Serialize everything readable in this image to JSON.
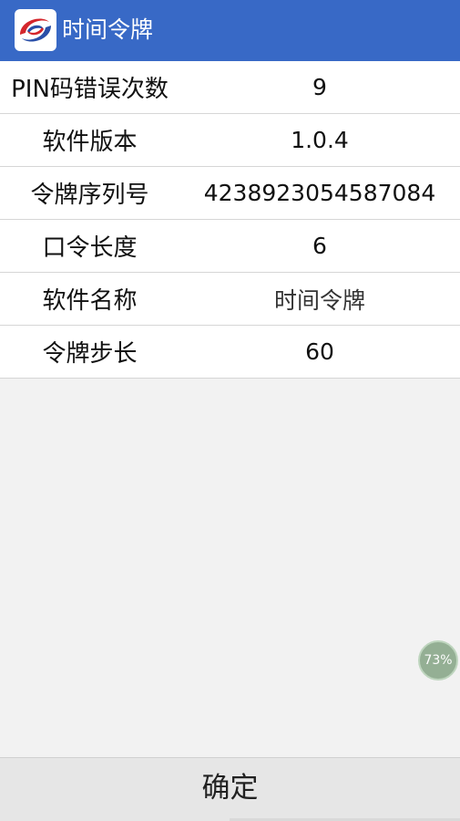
{
  "app": {
    "title": "时间令牌",
    "logo_icon": "token-app-logo-icon",
    "header_color": "#3869c6"
  },
  "info_rows": [
    {
      "label": "PIN码错误次数",
      "value": "9"
    },
    {
      "label": "软件版本",
      "value": "1.0.4"
    },
    {
      "label": "令牌序列号",
      "value": "4238923054587084"
    },
    {
      "label": "口令长度",
      "value": "6"
    },
    {
      "label": "软件名称",
      "value": "时间令牌"
    },
    {
      "label": "令牌步长",
      "value": "60"
    }
  ],
  "battery_overlay": {
    "text": "73%"
  },
  "confirm_button": {
    "label": "确定"
  }
}
